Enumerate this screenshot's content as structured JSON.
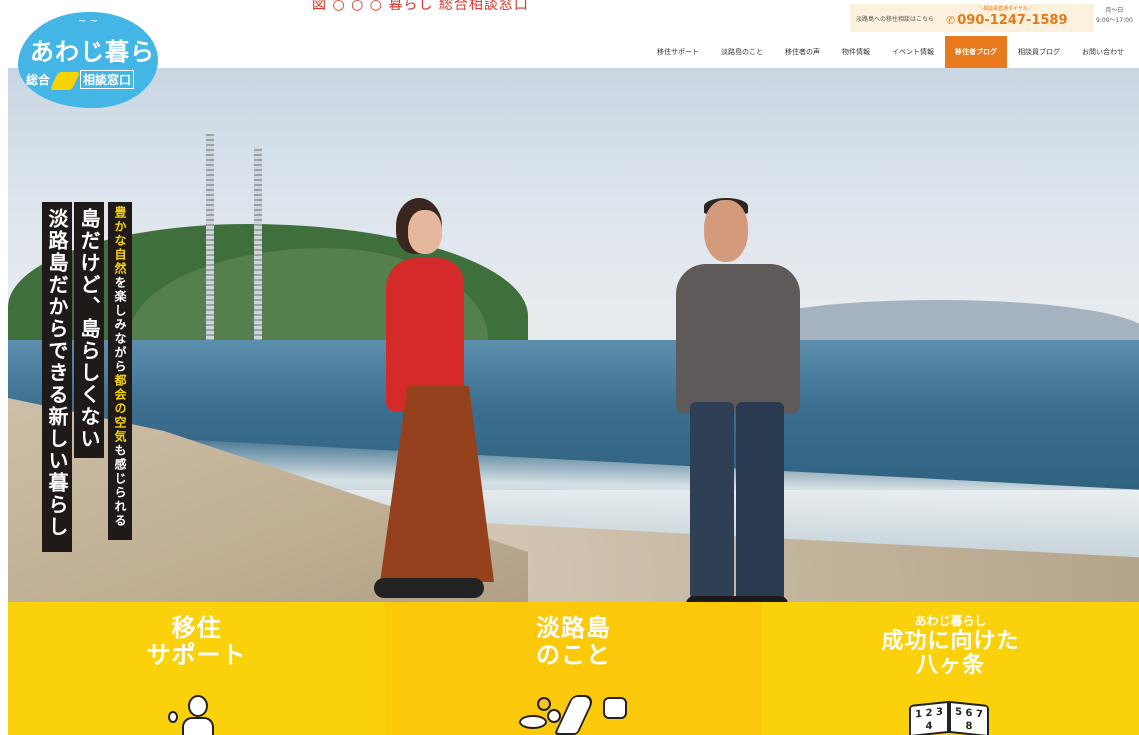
{
  "caption": "図 ○ ○ ○ 暮らし 総合相談窓口",
  "logo": {
    "title": "あわじ暮らし",
    "sub_left": "総合",
    "sub_right": "相談窓口"
  },
  "contact": {
    "lead": "淡路島への移住相談はこちら",
    "dial_label": "＼相談員直通ダイヤル／",
    "phone": "090-1247-1589",
    "days": "月〜日",
    "hours": "9:00〜17:00"
  },
  "nav": {
    "items": [
      "移住サポート",
      "淡路島のこと",
      "移住者の声",
      "物件情報",
      "イベント情報",
      "移住者ブログ",
      "相談員ブログ",
      "お問い合わせ"
    ],
    "active_index": 5
  },
  "hero": {
    "slogan_1": "淡路島だからできる新しい暮らし",
    "slogan_2": "島だけど、島らしくない",
    "slogan_3_parts": [
      "豊かな自然",
      "を楽しみながら",
      "都会の空気",
      "も感じられる"
    ]
  },
  "tiles": [
    {
      "title_line1": "移住",
      "title_line2": "サポート"
    },
    {
      "title_line1": "淡路島",
      "title_line2": "のこと"
    },
    {
      "pre": "あわじ暮らし",
      "title_line1": "成功に向けた",
      "title_line2": "八ヶ条",
      "book_left": "1 2 3 4",
      "book_right": "5 6 7 8"
    }
  ],
  "colors": {
    "accent_orange": "#e8791d",
    "tile_yellow": "#fbd10c",
    "logo_blue": "#43b6e6"
  }
}
